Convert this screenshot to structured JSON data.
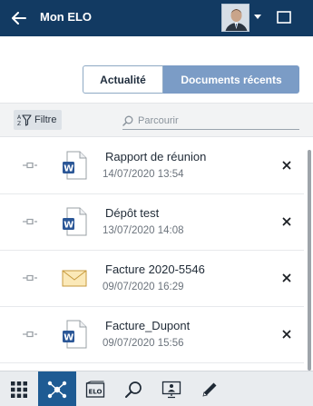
{
  "header": {
    "title": "Mon ELO",
    "back_icon": "arrow-left-icon",
    "color": "#123a62"
  },
  "tabs": [
    {
      "label": "Actualité",
      "active": false
    },
    {
      "label": "Documents récents",
      "active": true
    }
  ],
  "filter": {
    "label": "Filtre",
    "search_placeholder": "Parcourir"
  },
  "documents": [
    {
      "title": "Rapport de réunion",
      "date": "14/07/2020 13:54",
      "icon": "word-document-icon"
    },
    {
      "title": "Dépôt test",
      "date": "13/07/2020 14:08",
      "icon": "word-document-icon"
    },
    {
      "title": "Facture 2020-5546",
      "date": "09/07/2020 16:29",
      "icon": "email-envelope-icon"
    },
    {
      "title": "Facture_Dupont",
      "date": "09/07/2020 15:56",
      "icon": "word-document-icon"
    }
  ],
  "toolbar": {
    "items": [
      "grid-menu-icon",
      "network-icon",
      "elo-archive-icon",
      "search-icon",
      "presentation-icon",
      "pencil-icon"
    ],
    "active": "network-icon",
    "accent": "#1e5b93"
  }
}
